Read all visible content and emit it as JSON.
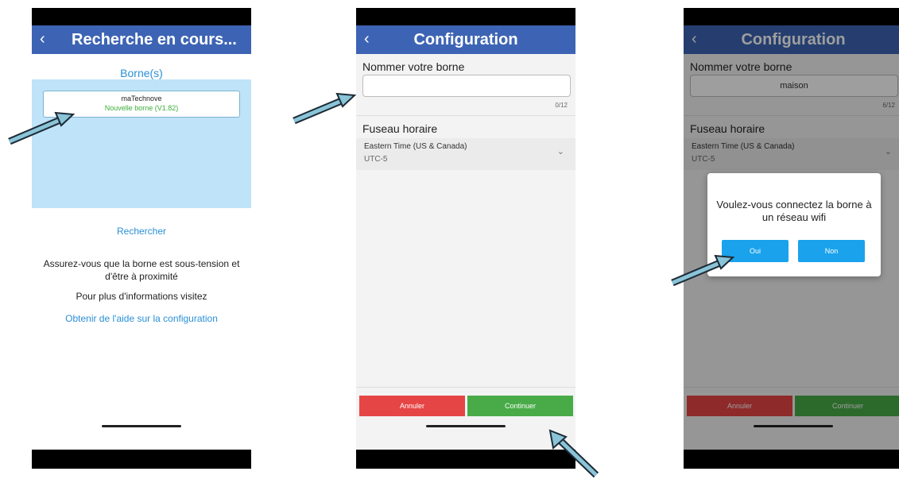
{
  "screen1": {
    "back_icon": "‹",
    "title": "Recherche en cours...",
    "subtitle": "Borne(s)",
    "device": {
      "name": "maTechnove",
      "version": "Nouvelle borne (V1.82)"
    },
    "search_label": "Rechercher",
    "info_text": "Assurez-vous que la borne est sous-tension et d'être à proximité",
    "more_info": "Pour plus d'informations visitez",
    "help_link": "Obtenir de l'aide sur la configuration"
  },
  "screen2": {
    "back_icon": "‹",
    "title": "Configuration",
    "name_label": "Nommer votre borne",
    "name_value": "",
    "name_counter": "0/12",
    "timezone_label": "Fuseau horaire",
    "timezone_name": "Eastern Time (US & Canada)",
    "timezone_offset": "UTC-5",
    "chevron": "⌄",
    "cancel_label": "Annuler",
    "continue_label": "Continuer"
  },
  "screen3": {
    "back_icon": "‹",
    "title": "Configuration",
    "name_label": "Nommer votre borne",
    "name_value": "maison",
    "name_counter": "6/12",
    "timezone_label": "Fuseau horaire",
    "timezone_name": "Eastern Time (US & Canada)",
    "timezone_offset": "UTC-5",
    "chevron": "⌄",
    "cancel_label": "Annuler",
    "continue_label": "Continuer",
    "dialog_message": "Voulez-vous connectez la borne à un réseau wifi",
    "yes_label": "Oui",
    "no_label": "Non"
  },
  "colors": {
    "header": "#3d64b4",
    "link": "#2a8fd6",
    "device_area": "#bfe3f8",
    "cancel": "#e64545",
    "continue": "#48ab48",
    "dialog_button": "#1aa2ec",
    "arrow": "#8ac4d8"
  }
}
